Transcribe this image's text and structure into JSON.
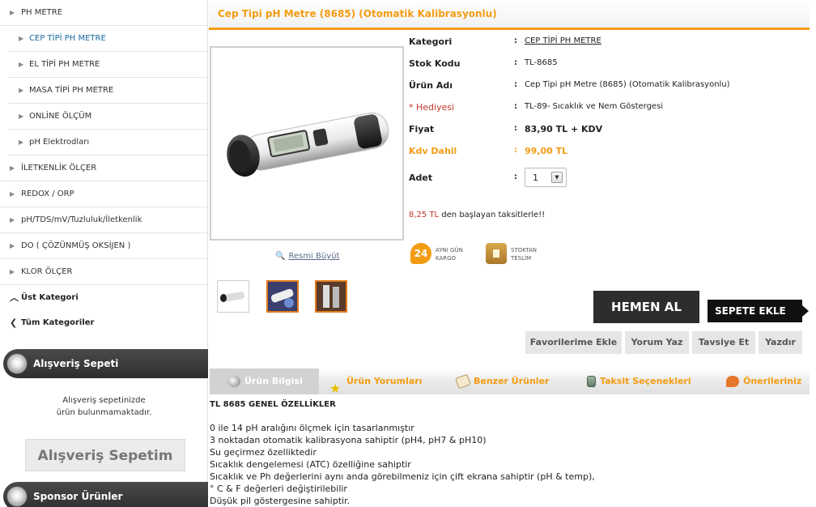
{
  "sidebar": {
    "categories": [
      {
        "label": "PH METRE"
      },
      {
        "label": "CEP TİPİ PH METRE"
      },
      {
        "label": "EL TİPİ PH METRE"
      },
      {
        "label": "MASA TİPİ PH METRE"
      },
      {
        "label": "ONLİNE ÖLÇÜM"
      },
      {
        "label": "pH Elektrodları"
      },
      {
        "label": "İLETKENLİK ÖLÇER"
      },
      {
        "label": "REDOX / ORP"
      },
      {
        "label": "pH/TDS/mV/Tuzluluk/İletkenlik"
      },
      {
        "label": "DO ( ÇÖZÜNMÜŞ OKSİJEN )"
      },
      {
        "label": "KLOR ÖLÇER"
      },
      {
        "label": "Üst Kategori"
      },
      {
        "label": "Tüm Kategoriler"
      }
    ],
    "cart_box": {
      "title": "Alışveriş Sepeti",
      "empty_line1": "Alışveriş sepetinizde",
      "empty_line2": "ürün bulunmamaktadır.",
      "button": "Alışveriş Sepetim"
    },
    "sponsor_box": {
      "title": "Sponsor Ürünler"
    }
  },
  "product": {
    "title": "Cep Tipi pH Metre (8685) (Otomatik Kalibrasyonlu)",
    "zoom_label": "Resmi Büyüt",
    "specs": {
      "category_label": "Kategori",
      "category_value": "CEP TİPİ PH METRE",
      "stock_label": "Stok Kodu",
      "stock_value": "TL-8685",
      "name_label": "Ürün Adı",
      "name_value": "Cep Tipi pH Metre (8685) (Otomatik Kalibrasyonlu)",
      "gift_label": "* Hediyesi",
      "gift_value": "TL-89- Sıcaklık ve Nem Göstergesi",
      "price_label": "Fiyat",
      "price_value": "83,90 TL + KDV",
      "vat_label": "Kdv Dahil",
      "vat_value": "99,00 TL",
      "qty_label": "Adet",
      "qty_value": "1",
      "colon": ":"
    },
    "installment": {
      "amount": "8,25 TL",
      "text": " den başlayan taksitlerle!!"
    },
    "badges": {
      "same_day_number": "24",
      "same_day_line1": "AYNI GÜN",
      "same_day_line2": "KARGO",
      "stock_line1": "STOKTAN",
      "stock_line2": "TESLİM"
    },
    "buy_now": "HEMEN AL",
    "add_to_cart": "SEPETE EKLE",
    "actions": {
      "favorites": "Favorilerime Ekle",
      "comment": "Yorum Yaz",
      "recommend": "Tavsiye Et",
      "print": "Yazdır"
    },
    "colors": {
      "accent": "#f39c12",
      "dark_button": "#2d2d2d",
      "price_red": "#c0392b"
    }
  },
  "tabs": [
    {
      "label": "Ürün Bilgisi",
      "icon": "magnifier-icon"
    },
    {
      "label": "Ürün Yorumları",
      "icon": "star-icon"
    },
    {
      "label": "Benzer Ürünler",
      "icon": "tag-icon"
    },
    {
      "label": "Taksit Seçenekleri",
      "icon": "calculator-icon"
    },
    {
      "label": "Önerileriniz",
      "icon": "speech-bubble-icon"
    }
  ],
  "description": {
    "heading": "TL 8685 GENEL ÖZELLİKLER",
    "lines": [
      "0 ile 14 pH aralığını ölçmek için tasarlanmıştır",
      "3 noktadan otomatik kalibrasyona sahiptir (pH4, pH7 & pH10)",
      "Su geçirmez özelliktedir",
      "Sıcaklık dengelemesi (ATC) özelliğine sahiptir",
      "Sıcaklık ve Ph değerlerini aynı anda görebilmeniz için çift ekrana sahiptir (pH & temp),",
      "° C & F değerleri değiştirilebilir",
      "Düşük pil göstergesine sahiptir."
    ]
  }
}
